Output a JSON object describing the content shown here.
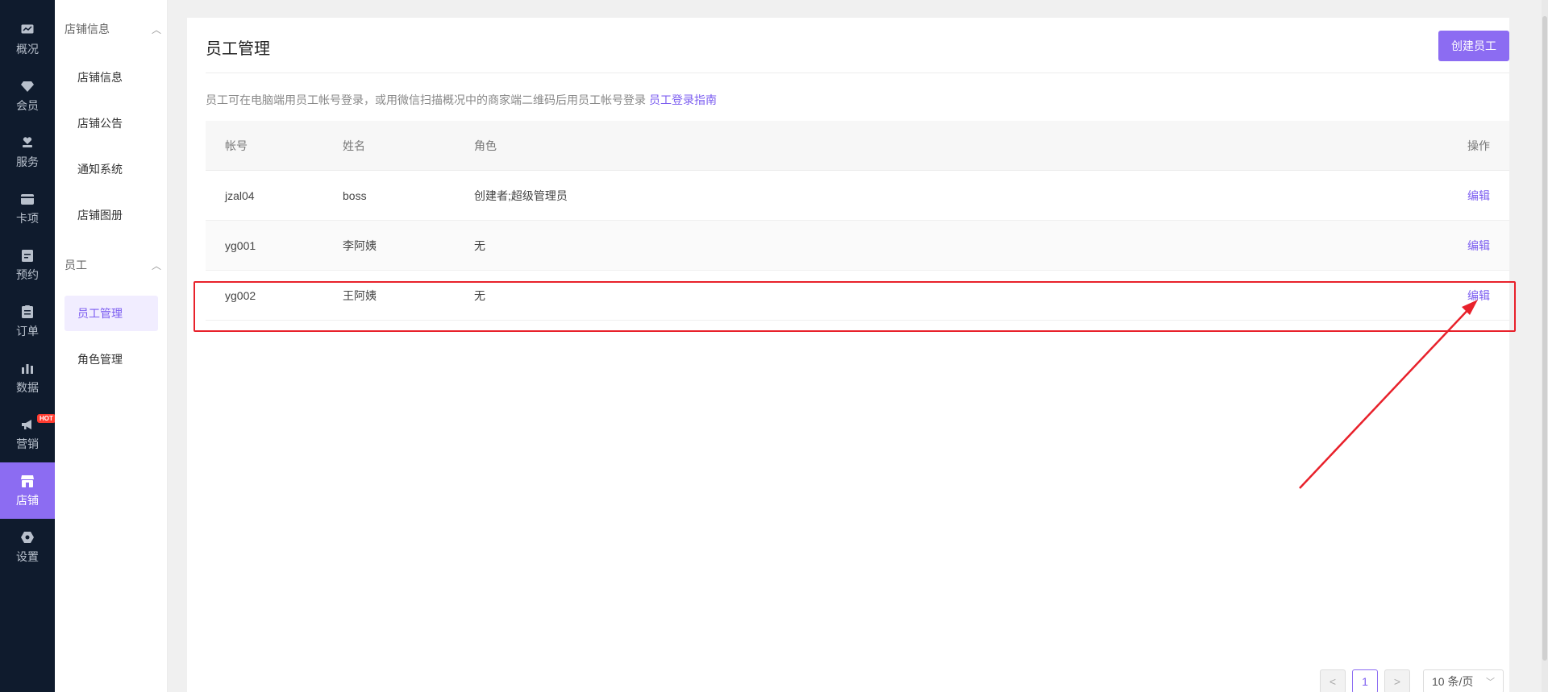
{
  "rail": {
    "items": [
      {
        "label": "概况",
        "icon": "dashboard-icon"
      },
      {
        "label": "会员",
        "icon": "diamond-icon"
      },
      {
        "label": "服务",
        "icon": "heart-hand-icon"
      },
      {
        "label": "卡项",
        "icon": "card-icon"
      },
      {
        "label": "预约",
        "icon": "calendar-icon"
      },
      {
        "label": "订单",
        "icon": "clipboard-icon"
      },
      {
        "label": "数据",
        "icon": "bar-chart-icon"
      },
      {
        "label": "营销",
        "icon": "megaphone-icon",
        "badge": "HOT"
      },
      {
        "label": "店铺",
        "icon": "store-icon",
        "active": true
      },
      {
        "label": "设置",
        "icon": "gear-icon"
      }
    ]
  },
  "submenu": {
    "group1": {
      "title": "店铺信息",
      "items": [
        "店铺信息",
        "店铺公告",
        "通知系统",
        "店铺图册"
      ]
    },
    "group2": {
      "title": "员工",
      "items": [
        "员工管理",
        "角色管理"
      ]
    }
  },
  "main": {
    "title": "员工管理",
    "create_button": "创建员工",
    "hint_text": "员工可在电脑端用员工帐号登录，或用微信扫描概况中的商家端二维码后用员工帐号登录",
    "hint_link": "员工登录指南"
  },
  "table": {
    "headers": {
      "account": "帐号",
      "name": "姓名",
      "role": "角色",
      "action": "操作"
    },
    "rows": [
      {
        "account": "jzal04",
        "name": "boss",
        "role": "创建者;超级管理员",
        "action": "编辑"
      },
      {
        "account": "yg001",
        "name": "李阿姨",
        "role": "无",
        "action": "编辑"
      },
      {
        "account": "yg002",
        "name": "王阿姨",
        "role": "无",
        "action": "编辑"
      }
    ]
  },
  "pagination": {
    "current_page": "1",
    "prev": "<",
    "next": ">",
    "page_size": "10 条/页"
  },
  "colors": {
    "accent": "#8c6cf2",
    "rail_bg": "#0f1b2d",
    "annotation": "#e8212b"
  }
}
